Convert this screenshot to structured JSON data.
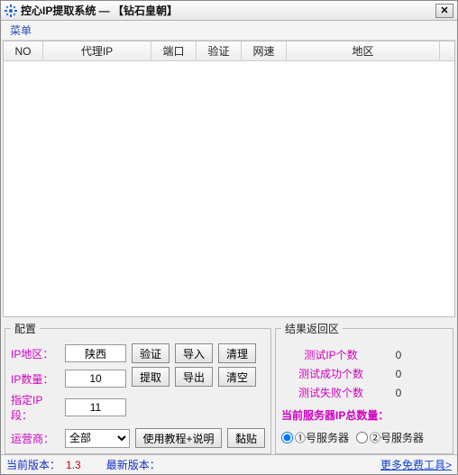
{
  "titlebar": {
    "title": "控心IP提取系统 — 【钻石皇朝】"
  },
  "menu": {
    "label": "菜单"
  },
  "table": {
    "columns": [
      {
        "label": "NO",
        "width": 44
      },
      {
        "label": "代理IP",
        "width": 120
      },
      {
        "label": "端口",
        "width": 50
      },
      {
        "label": "验证",
        "width": 50
      },
      {
        "label": "网速",
        "width": 50
      },
      {
        "label": "地区",
        "width": 170
      }
    ],
    "rows": []
  },
  "config": {
    "legend": "配置",
    "ip_region_label": "IP地区：",
    "ip_region_value": "陕西",
    "ip_count_label": "IP数量：",
    "ip_count_value": "10",
    "ip_segment_label": "指定IP段：",
    "ip_segment_value": "11",
    "isp_label": "运营商：",
    "isp_value": "全部",
    "buttons": {
      "verify": "验证",
      "import": "导入",
      "cleanup": "清理",
      "extract": "提取",
      "export": "导出",
      "clear": "清空",
      "tutorial": "使用教程+说明",
      "paste": "黏贴"
    }
  },
  "results": {
    "legend": "结果返回区",
    "test_ip_label": "测试IP个数",
    "test_ip_value": "0",
    "test_ok_label": "测试成功个数",
    "test_ok_value": "0",
    "test_fail_label": "测试失败个数",
    "test_fail_value": "0",
    "total_label": "当前服务器IP总数量：",
    "server1": "①号服务器",
    "server2": "②号服务器"
  },
  "status": {
    "cur_label": "当前版本：",
    "cur_value": "1.3",
    "latest_label": "最新版本：",
    "more": "更多免费工具>"
  }
}
